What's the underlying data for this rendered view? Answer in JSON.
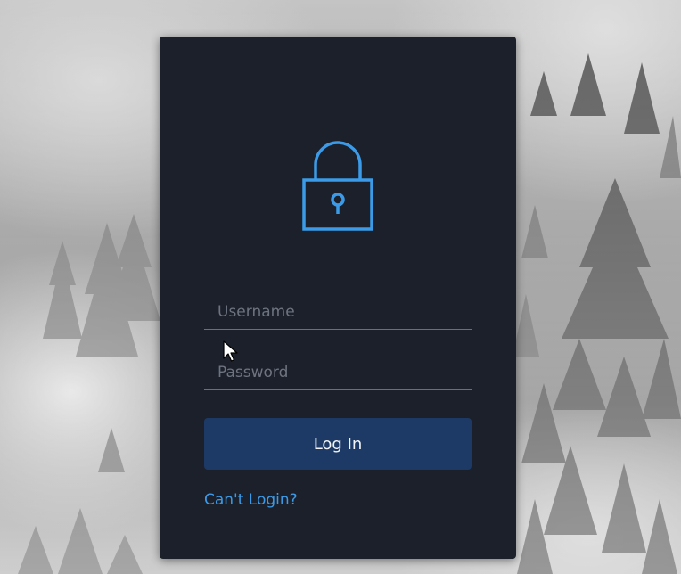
{
  "login": {
    "username_placeholder": "Username",
    "password_placeholder": "Password",
    "login_button_label": "Log In",
    "cant_login_label": "Can't Login?"
  },
  "icons": {
    "lock": "lock-icon",
    "cursor": "mouse-pointer-icon"
  },
  "colors": {
    "card_background": "#1b202b",
    "accent": "#3b9be8",
    "button_background": "#1c3a65",
    "button_text": "#f2f4f7",
    "placeholder": "#6e7380"
  }
}
